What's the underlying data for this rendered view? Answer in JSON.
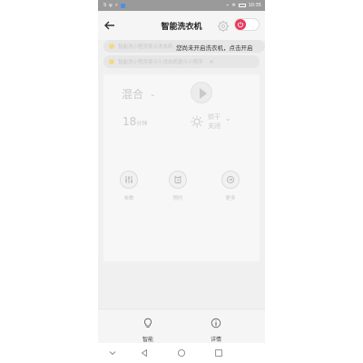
{
  "status_bar": {
    "time": "10:35",
    "left_marks": [
      "S",
      "ψ",
      "⚡"
    ],
    "right_marks": [
      "⌁",
      "✲"
    ]
  },
  "header": {
    "title": "智能洗衣机"
  },
  "notices": [
    {
      "text": "智能洗小程序提示洗衣机",
      "close": "×"
    },
    {
      "text": "智能洗小程序提示小洗衣机提示小程序",
      "close": "×"
    }
  ],
  "popup": {
    "text": "您尚未开启洗衣机，点击开启"
  },
  "card": {
    "mode": "混合",
    "mode_chevron": "⌄",
    "time_value": "18",
    "time_unit": "分钟",
    "dry_label": "烘干",
    "dry_value": "关闭",
    "dry_chevron": "⌄",
    "actions": [
      {
        "label": "参数"
      },
      {
        "label": "预约"
      },
      {
        "label": "更多"
      }
    ]
  },
  "bottom_bar": {
    "items": [
      {
        "label": "智能"
      },
      {
        "label": "详情"
      }
    ]
  },
  "colors": {
    "accent": "#e83a5a",
    "muted_text": "#c9c9c9",
    "status_bar": "#9a9a9a"
  }
}
